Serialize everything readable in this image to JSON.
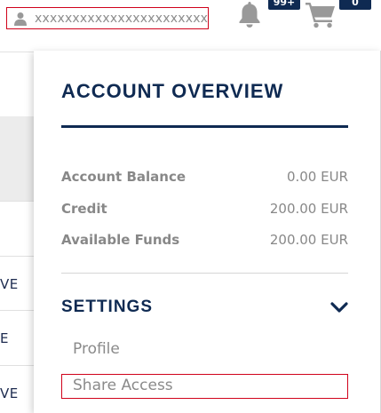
{
  "header": {
    "user_name": "xxxxxxxxxxxxxxxxxxxxxxxxxx",
    "notifications_badge": "99+",
    "cart_badge": "0",
    "icons": [
      "user-icon",
      "bell-icon",
      "cart-icon"
    ]
  },
  "background": {
    "row_texts": [
      "VE",
      "E",
      "VE"
    ]
  },
  "panel": {
    "title": "ACCOUNT OVERVIEW",
    "stats": [
      {
        "label": "Account Balance",
        "value": "0.00 EUR"
      },
      {
        "label": "Credit",
        "value": "200.00 EUR"
      },
      {
        "label": "Available Funds",
        "value": "200.00 EUR"
      }
    ],
    "settings": {
      "label": "SETTINGS",
      "items": [
        {
          "label": "Profile"
        },
        {
          "label": "Share Access"
        }
      ]
    }
  },
  "colors": {
    "navy": "#0f2a52",
    "highlight_red": "#d0021b",
    "gray_text": "#888888",
    "icon_gray": "#999999"
  }
}
